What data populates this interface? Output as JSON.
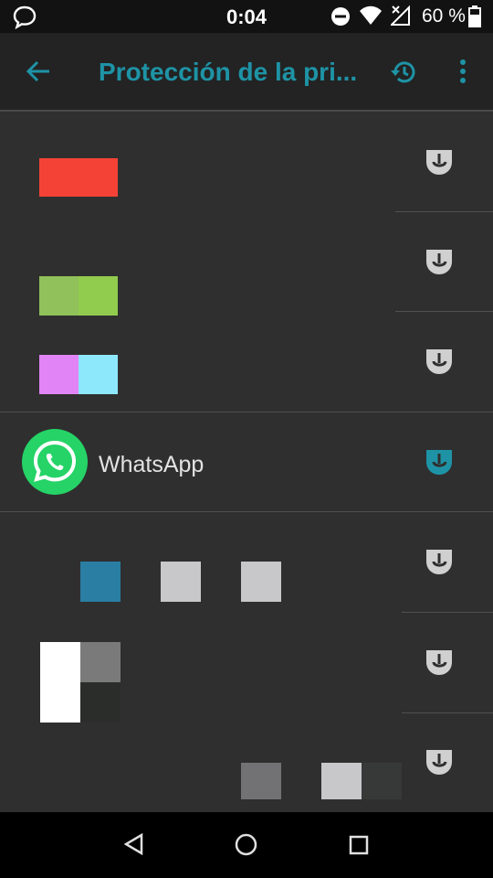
{
  "status_bar": {
    "time": "0:04",
    "battery": "60 %",
    "icons": [
      "chat-bubble-icon",
      "do-not-disturb-icon",
      "wifi-icon",
      "no-signal-icon",
      "battery-icon"
    ]
  },
  "app_bar": {
    "title": "Protección de la pri...",
    "back_icon": "arrow-back-icon",
    "reset_icon": "history-icon",
    "menu_icon": "more-vert-icon",
    "accent": "#1e93a6"
  },
  "apps": [
    {
      "name": "",
      "state": "off"
    },
    {
      "name": "",
      "state": "off"
    },
    {
      "name": "",
      "state": "off"
    },
    {
      "name": "WhatsApp",
      "state": "on"
    },
    {
      "name": "",
      "state": "off"
    },
    {
      "name": "",
      "state": "off"
    },
    {
      "name": "",
      "state": "off"
    }
  ],
  "nav_bar": {
    "icons": [
      "back-triangle-icon",
      "home-circle-icon",
      "recents-square-icon"
    ]
  }
}
